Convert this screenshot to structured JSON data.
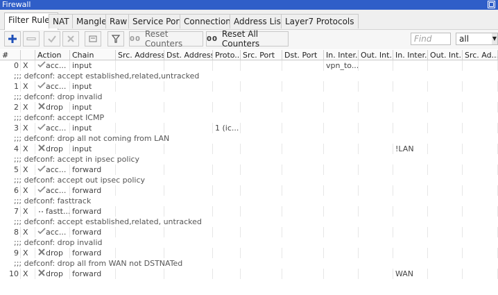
{
  "window": {
    "title": "Firewall"
  },
  "tabs": [
    {
      "label": "Filter Rules",
      "active": true
    },
    {
      "label": "NAT"
    },
    {
      "label": "Mangle"
    },
    {
      "label": "Raw"
    },
    {
      "label": "Service Ports"
    },
    {
      "label": "Connections"
    },
    {
      "label": "Address Lists"
    },
    {
      "label": "Layer7 Protocols"
    }
  ],
  "toolbar": {
    "reset_counters": "Reset Counters",
    "reset_all_counters": "Reset All Counters",
    "counter_badge": "00",
    "find_placeholder": "Find",
    "filter_value": "all"
  },
  "columns": [
    "#",
    "",
    "Action",
    "Chain",
    "Src. Address",
    "Dst. Address",
    "Proto...",
    "Src. Port",
    "Dst. Port",
    "In. Inter...",
    "Out. Int...",
    "In. Inter...",
    "Out. Int...",
    "Src. Ad..."
  ],
  "rows": [
    {
      "type": "rule",
      "num": "0",
      "flag": "X",
      "icon": "accept",
      "action": "acc...",
      "chain": "input",
      "in_iface": "vpn_to..."
    },
    {
      "type": "comment",
      "text": ";;; defconf: accept established,related,untracked"
    },
    {
      "type": "rule",
      "num": "1",
      "flag": "X",
      "icon": "accept",
      "action": "acc...",
      "chain": "input"
    },
    {
      "type": "comment",
      "text": ";;; defconf: drop invalid"
    },
    {
      "type": "rule",
      "num": "2",
      "flag": "X",
      "icon": "drop",
      "action": "drop",
      "chain": "input"
    },
    {
      "type": "comment",
      "text": ";;; defconf: accept ICMP"
    },
    {
      "type": "rule",
      "num": "3",
      "flag": "X",
      "icon": "accept",
      "action": "acc...",
      "chain": "input",
      "proto": "1 (ic..."
    },
    {
      "type": "comment",
      "text": ";;; defconf: drop all not coming from LAN"
    },
    {
      "type": "rule",
      "num": "4",
      "flag": "X",
      "icon": "drop",
      "action": "drop",
      "chain": "input",
      "in_iface_list": "!LAN"
    },
    {
      "type": "comment",
      "text": ";;; defconf: accept in ipsec policy"
    },
    {
      "type": "rule",
      "num": "5",
      "flag": "X",
      "icon": "accept",
      "action": "acc...",
      "chain": "forward"
    },
    {
      "type": "comment",
      "text": ";;; defconf: accept out ipsec policy"
    },
    {
      "type": "rule",
      "num": "6",
      "flag": "X",
      "icon": "accept",
      "action": "acc...",
      "chain": "forward"
    },
    {
      "type": "comment",
      "text": ";;; defconf: fasttrack"
    },
    {
      "type": "rule",
      "num": "7",
      "flag": "X",
      "icon": "fasttrack",
      "action": "fastt...",
      "chain": "forward"
    },
    {
      "type": "comment",
      "text": ";;; defconf: accept established,related, untracked"
    },
    {
      "type": "rule",
      "num": "8",
      "flag": "X",
      "icon": "accept",
      "action": "acc...",
      "chain": "forward"
    },
    {
      "type": "comment",
      "text": ";;; defconf: drop invalid"
    },
    {
      "type": "rule",
      "num": "9",
      "flag": "X",
      "icon": "drop",
      "action": "drop",
      "chain": "forward"
    },
    {
      "type": "comment",
      "text": ";;; defconf:  drop all from WAN not DSTNATed"
    },
    {
      "type": "rule",
      "num": "10",
      "flag": "X",
      "icon": "drop",
      "action": "drop",
      "chain": "forward",
      "in_iface_list": "WAN"
    }
  ]
}
